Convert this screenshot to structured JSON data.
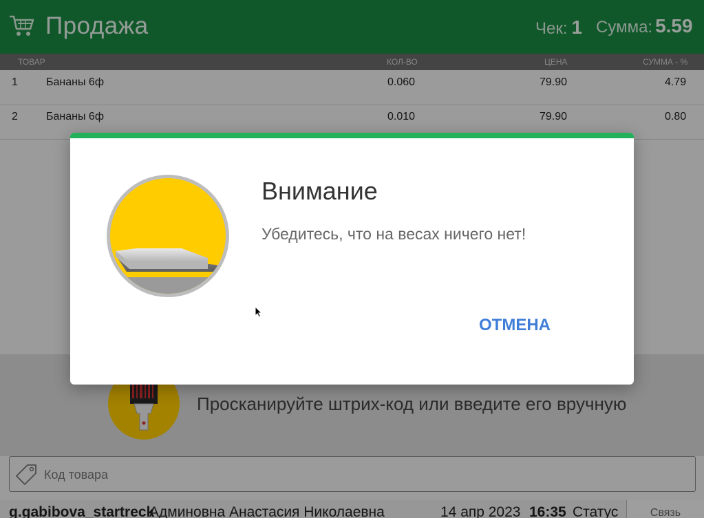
{
  "header": {
    "title": "Продажа",
    "check_label": "Чек:",
    "check_value": "1",
    "sum_label": "Сумма:",
    "sum_value": "5.59"
  },
  "table": {
    "columns": [
      "ТОВАР",
      "КОЛ-ВО",
      "ЦЕНА",
      "СУММА - %"
    ],
    "rows": [
      {
        "num": "1",
        "name": "Бананы 6ф",
        "qty": "0.060",
        "price": "79.90",
        "sum": "4.79"
      },
      {
        "num": "2",
        "name": "Бананы 6ф",
        "qty": "0.010",
        "price": "79.90",
        "sum": "0.80"
      }
    ]
  },
  "scan": {
    "text": "Просканируйте штрих-код или введите его вручную",
    "placeholder": "Код товара"
  },
  "status": {
    "login": "g.gabibova_startreck",
    "user": "Админовна Анастасия Николаевна",
    "date": "14 апр 2023",
    "time": "16:35",
    "status_label": "Статус",
    "link_label": "Связь"
  },
  "modal": {
    "title": "Внимание",
    "message": "Убедитесь, что на весах ничего нет!",
    "cancel_label": "ОТМЕНА"
  },
  "colors": {
    "header_bg": "#1a8a43",
    "modal_accent": "#22b05a",
    "button_text": "#3f7dd9",
    "icon_yellow": "#ffcc00"
  }
}
